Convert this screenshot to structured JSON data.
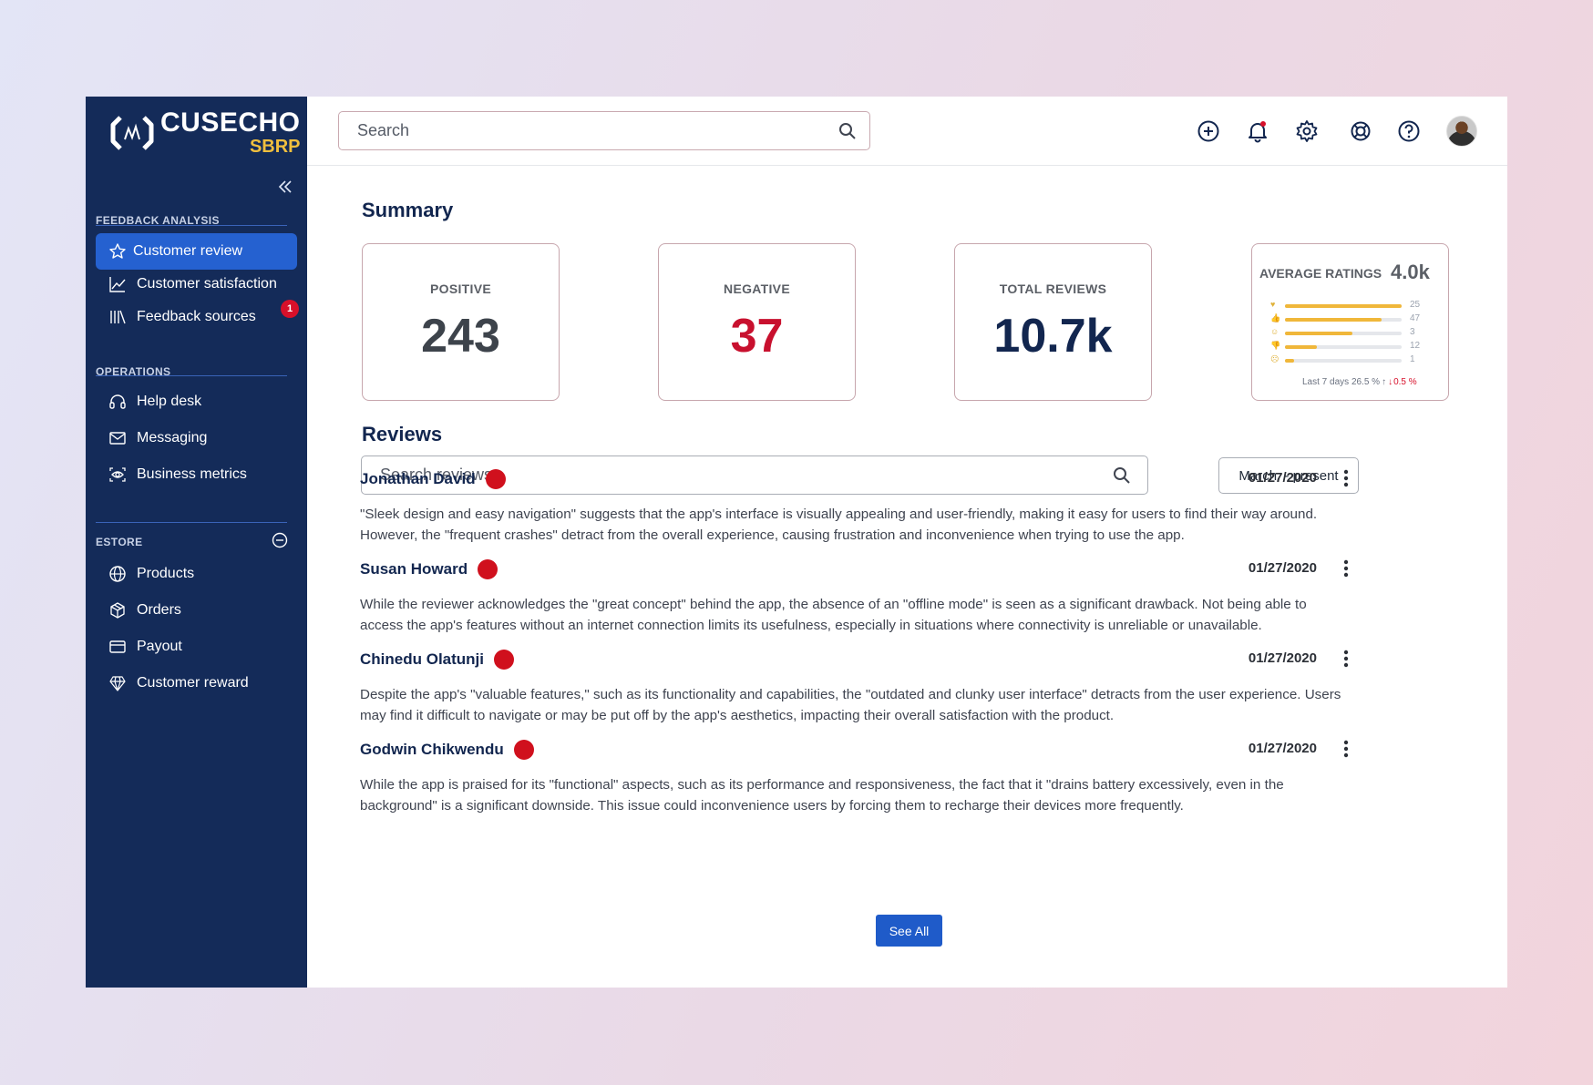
{
  "brand": {
    "title": "CUSECHO",
    "subtitle": "SBRP"
  },
  "sidebar": {
    "sections": [
      {
        "label": "FEEDBACK ANALYSIS"
      },
      {
        "label": "OPERATIONS"
      },
      {
        "label": "ESTORE"
      }
    ],
    "items": [
      {
        "label": "Customer review",
        "icon": "star-icon",
        "active": true
      },
      {
        "label": "Customer satisfaction",
        "icon": "line-chart-icon",
        "badge": "1"
      },
      {
        "label": "Feedback sources",
        "icon": "library-icon"
      },
      {
        "label": "Help desk",
        "icon": "headset-icon"
      },
      {
        "label": "Messaging",
        "icon": "mail-icon"
      },
      {
        "label": "Business metrics",
        "icon": "eye-scan-icon"
      },
      {
        "label": "Products",
        "icon": "globe-icon"
      },
      {
        "label": "Orders",
        "icon": "package-icon"
      },
      {
        "label": "Payout",
        "icon": "credit-card-icon"
      },
      {
        "label": "Customer reward",
        "icon": "diamond-icon"
      }
    ]
  },
  "header": {
    "search_placeholder": "Search",
    "icons": [
      "add-circle-icon",
      "bell-icon",
      "gear-icon",
      "support-lifebuoy-icon",
      "help-icon",
      "avatar"
    ]
  },
  "summary": {
    "title": "Summary",
    "positive": {
      "label": "POSITIVE",
      "value": "243",
      "color": "#3d434b"
    },
    "negative": {
      "label": "NEGATIVE",
      "value": "37",
      "color": "#c8102e"
    },
    "total": {
      "label": "TOTAL REVIEWS",
      "value": "10.7k",
      "color": "#12264f"
    },
    "ratings": {
      "label": "AVERAGE RATINGS",
      "total": "4.0k",
      "rows": [
        {
          "icon": "heart-icon",
          "glyph": "♥",
          "count": "25",
          "fill": 1.0
        },
        {
          "icon": "thumbs-up-icon",
          "glyph": "👍",
          "count": "47",
          "fill": 0.83
        },
        {
          "icon": "smile-icon",
          "glyph": "☺",
          "count": "3",
          "fill": 0.58
        },
        {
          "icon": "thumbs-down-icon",
          "glyph": "👎",
          "count": "12",
          "fill": 0.27
        },
        {
          "icon": "frown-icon",
          "glyph": "☹",
          "count": "1",
          "fill": 0.08
        }
      ],
      "footer_label": "Last 7 days",
      "footer_up": "26.5 %",
      "footer_down": "0.5 %"
    }
  },
  "reviews": {
    "title": "Reviews",
    "search_placeholder": "Search reviews",
    "date_filter": "March  - present",
    "items": [
      {
        "name": "Jonathan David",
        "date": "01/27/2020",
        "text": "\"Sleek design and easy navigation\" suggests that the app's interface is visually appealing and user-friendly, making it easy for users to find their way around. However, the \"frequent crashes\" detract from the overall experience, causing frustration and inconvenience when trying to use the app."
      },
      {
        "name": "Susan Howard",
        "date": "01/27/2020",
        "text": "While the reviewer acknowledges the \"great concept\" behind the app, the absence of an \"offline mode\" is seen as a significant drawback. Not being able to access the app's features without an internet connection limits its usefulness, especially in situations where connectivity is unreliable or unavailable."
      },
      {
        "name": "Chinedu Olatunji",
        "date": "01/27/2020",
        "text": "Despite the app's \"valuable features,\" such as its functionality and capabilities, the \"outdated and clunky user interface\" detracts from the user experience. Users may find it difficult to navigate or may be put off by the app's aesthetics, impacting their overall satisfaction with the product."
      },
      {
        "name": "Godwin Chikwendu",
        "date": "01/27/2020",
        "text": "While the app is praised for its \"functional\" aspects, such as its performance and responsiveness, the fact that it \"drains battery excessively, even in the background\" is a significant downside. This issue could inconvenience users by forcing them to recharge their devices more frequently."
      }
    ],
    "see_all": "See All"
  }
}
